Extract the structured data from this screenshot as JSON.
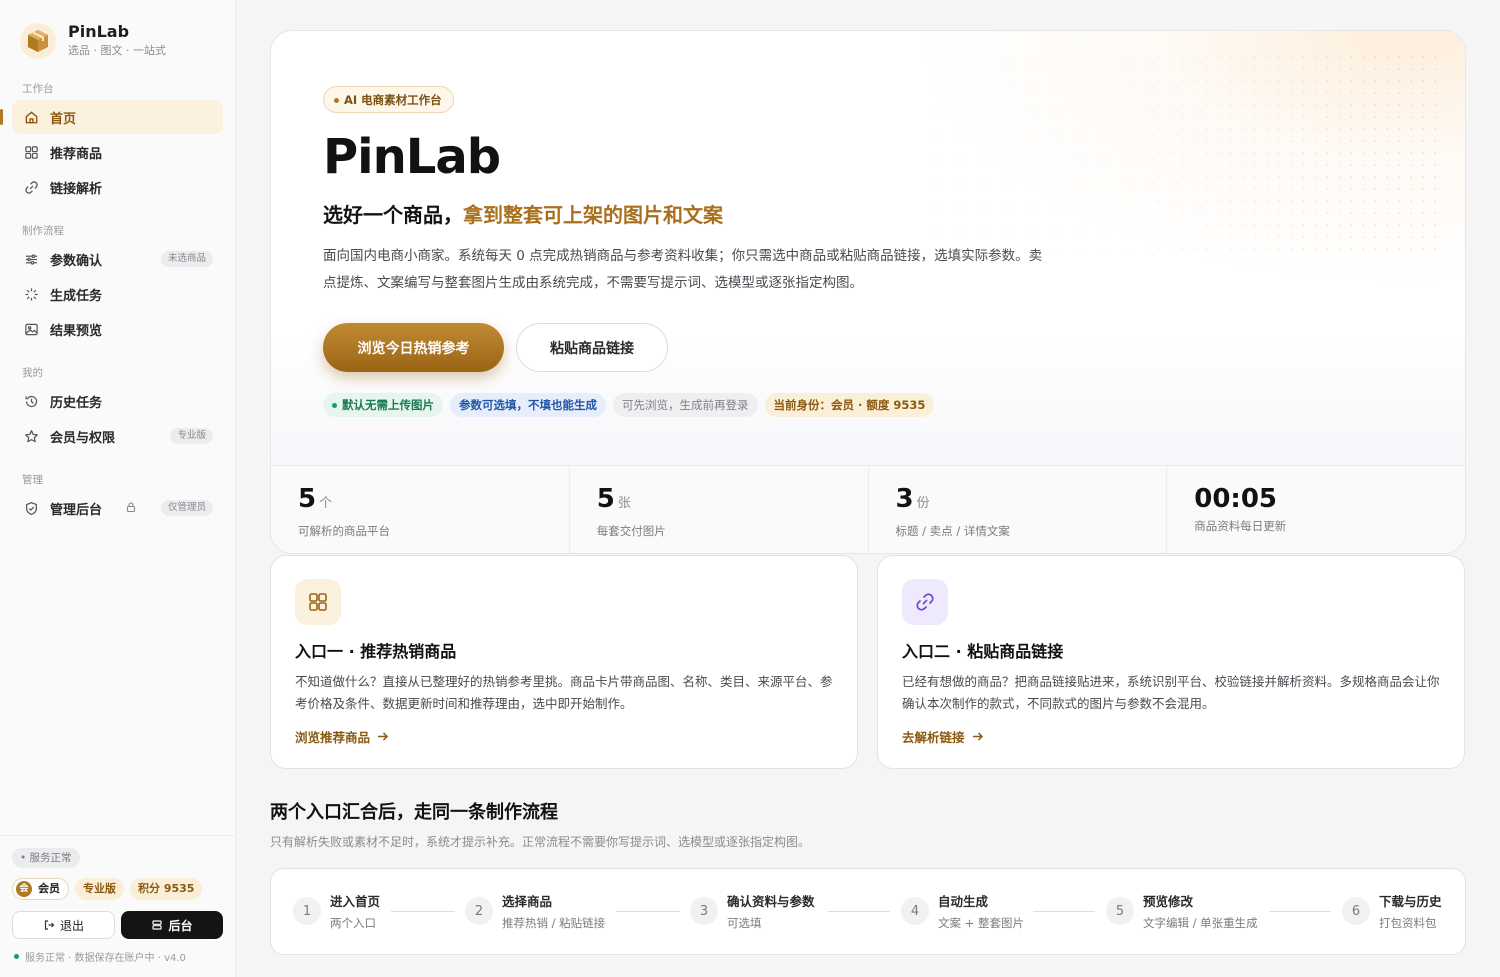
{
  "brand": {
    "name": "PinLab",
    "tagline": "选品 · 图文 · 一站式"
  },
  "sidebar": {
    "sections": [
      {
        "title": "工作台"
      },
      {
        "title": "制作流程"
      },
      {
        "title": "我的"
      },
      {
        "title": "管理"
      }
    ],
    "items": [
      {
        "label": "首页",
        "icon": "home-icon",
        "active": true
      },
      {
        "label": "推荐商品",
        "icon": "grid-icon"
      },
      {
        "label": "链接解析",
        "icon": "link-icon"
      },
      {
        "label": "参数确认",
        "icon": "sliders-icon",
        "badge": "未选商品"
      },
      {
        "label": "生成任务",
        "icon": "sparkle-icon"
      },
      {
        "label": "结果预览",
        "icon": "image-icon"
      },
      {
        "label": "历史任务",
        "icon": "history-icon"
      },
      {
        "label": "会员与权限",
        "icon": "star-icon",
        "badge": "专业版"
      },
      {
        "label": "管理后台",
        "icon": "shield-icon",
        "badge": "仅管理员",
        "locked": true
      }
    ],
    "footer": {
      "service_status": "服务正常",
      "member_mark": "会",
      "member_label": "会员",
      "plan": "专业版",
      "points": "积分 9535",
      "logout_label": "退出",
      "admin_label": "后台",
      "note": "服务正常 · 数据保存在账户中 · v4.0"
    }
  },
  "hero": {
    "eyebrow": "AI 电商素材工作台",
    "title": "PinLab",
    "subtitle_plain": "选好一个商品，",
    "subtitle_accent": "拿到整套可上架的图片和文案",
    "description": "面向国内电商小商家。系统每天 0 点完成热销商品与参考资料收集；你只需选中商品或粘贴商品链接，选填实际参数。卖点提炼、文案编写与整套图片生成由系统完成，不需要写提示词、选模型或逐张指定构图。",
    "primary_cta": "浏览今日热销参考",
    "secondary_cta": "粘贴商品链接",
    "tags": [
      {
        "text": "默认无需上传图片",
        "tone": "green"
      },
      {
        "text": "参数可选填，不填也能生成",
        "tone": "blue"
      },
      {
        "text": "可先浏览，生成前再登录",
        "tone": "gray"
      },
      {
        "text": "当前身份：会员 · 额度 9535",
        "tone": "gold"
      }
    ],
    "stats": [
      {
        "value": "5",
        "unit": "个",
        "label": "可解析的商品平台"
      },
      {
        "value": "5",
        "unit": "张",
        "label": "每套交付图片"
      },
      {
        "value": "3",
        "unit": "份",
        "label": "标题 / 卖点 / 详情文案"
      },
      {
        "value": "00:05",
        "unit": "",
        "label": "商品资料每日更新"
      }
    ]
  },
  "entries": [
    {
      "icon": "grid-icon",
      "title": "入口一 · 推荐热销商品",
      "description": "不知道做什么？直接从已整理好的热销参考里挑。商品卡片带商品图、名称、类目、来源平台、参考价格及条件、数据更新时间和推荐理由，选中即开始制作。",
      "link": "浏览推荐商品"
    },
    {
      "icon": "link-icon",
      "title": "入口二 · 粘贴商品链接",
      "description": "已经有想做的商品？把商品链接贴进来，系统识别平台、校验链接并解析资料。多规格商品会让你确认本次制作的款式，不同款式的图片与参数不会混用。",
      "link": "去解析链接"
    }
  ],
  "flow": {
    "title": "两个入口汇合后，走同一条制作流程",
    "subtitle": "只有解析失败或素材不足时，系统才提示补充。正常流程不需要你写提示词、选模型或逐张指定构图。",
    "steps": [
      {
        "num": "1",
        "title": "进入首页",
        "sub": "两个入口"
      },
      {
        "num": "2",
        "title": "选择商品",
        "sub": "推荐热销 / 粘贴链接"
      },
      {
        "num": "3",
        "title": "确认资料与参数",
        "sub": "可选填"
      },
      {
        "num": "4",
        "title": "自动生成",
        "sub": "文案 + 整套图片"
      },
      {
        "num": "5",
        "title": "预览修改",
        "sub": "文字编辑 / 单张重生成"
      },
      {
        "num": "6",
        "title": "下载与历史",
        "sub": "打包资料包"
      }
    ]
  },
  "colors": {
    "accent": "#a8701c",
    "accent_dark": "#8a5a10",
    "active_bg": "#fcf1df",
    "success": "#1a9a6a",
    "info": "#2456a8"
  }
}
